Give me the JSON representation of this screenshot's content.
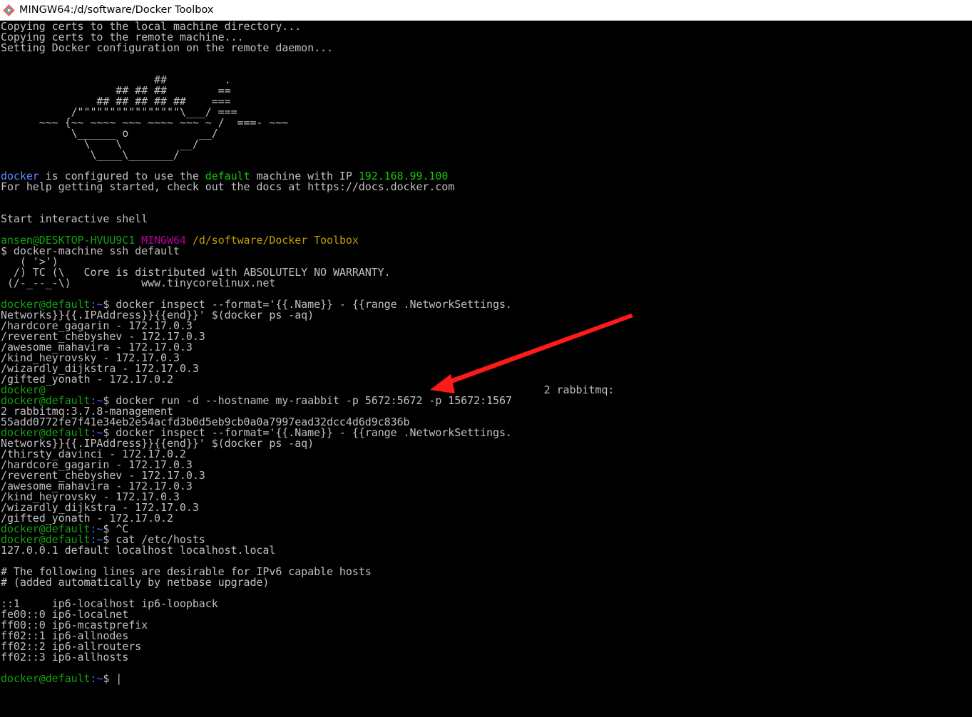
{
  "window": {
    "title": "MINGW64:/d/software/Docker Toolbox",
    "icon": "git-bash-icon"
  },
  "terminal": {
    "lines": [
      {
        "row": 0,
        "segs": [
          {
            "t": "Copying certs to the local machine directory...",
            "c": "white"
          }
        ]
      },
      {
        "row": 1,
        "segs": [
          {
            "t": "Copying certs to the remote machine...",
            "c": "white"
          }
        ]
      },
      {
        "row": 2,
        "segs": [
          {
            "t": "Setting Docker configuration on the remote daemon...",
            "c": "white"
          }
        ]
      },
      {
        "row": 5,
        "segs": [
          {
            "t": "                        ##         .",
            "c": "white"
          }
        ]
      },
      {
        "row": 6,
        "segs": [
          {
            "t": "                  ## ## ##        ==",
            "c": "white"
          }
        ]
      },
      {
        "row": 7,
        "segs": [
          {
            "t": "               ## ## ## ## ##    ===",
            "c": "white"
          }
        ]
      },
      {
        "row": 8,
        "segs": [
          {
            "t": "           /\"\"\"\"\"\"\"\"\"\"\"\"\"\"\"\"\\___/ ===",
            "c": "white"
          }
        ]
      },
      {
        "row": 9,
        "segs": [
          {
            "t": "      ~~~ {~~ ~~~~ ~~~ ~~~~ ~~~ ~ /  ===- ~~~",
            "c": "white"
          }
        ]
      },
      {
        "row": 10,
        "segs": [
          {
            "t": "           \\______ o           __/",
            "c": "white"
          }
        ]
      },
      {
        "row": 11,
        "segs": [
          {
            "t": "             \\    \\         __/",
            "c": "white"
          }
        ]
      },
      {
        "row": 12,
        "segs": [
          {
            "t": "              \\____\\_______/",
            "c": "white"
          }
        ]
      },
      {
        "row": 14,
        "segs": [
          {
            "t": "docker",
            "c": "bblue"
          },
          {
            "t": " is configured to use the ",
            "c": "white"
          },
          {
            "t": "default",
            "c": "bgreen"
          },
          {
            "t": " machine with IP ",
            "c": "white"
          },
          {
            "t": "192.168.99.100",
            "c": "bgreen"
          }
        ]
      },
      {
        "row": 15,
        "segs": [
          {
            "t": "For help getting started, check out the docs at https://docs.docker.com",
            "c": "white"
          }
        ]
      },
      {
        "row": 18,
        "segs": [
          {
            "t": "Start interactive shell",
            "c": "white"
          }
        ]
      },
      {
        "row": 20,
        "segs": [
          {
            "t": "ansen@DESKTOP-HVUU9C1",
            "c": "green"
          },
          {
            "t": " ",
            "c": "white"
          },
          {
            "t": "MINGW64",
            "c": "magenta"
          },
          {
            "t": " ",
            "c": "white"
          },
          {
            "t": "/d/software/Docker Toolbox",
            "c": "yellow"
          }
        ]
      },
      {
        "row": 21,
        "segs": [
          {
            "t": "$ docker-machine ssh default",
            "c": "white"
          }
        ]
      },
      {
        "row": 22,
        "segs": [
          {
            "t": "   ( '>')",
            "c": "white"
          }
        ]
      },
      {
        "row": 23,
        "segs": [
          {
            "t": "  /) TC (\\   Core is distributed with ABSOLUTELY NO WARRANTY.",
            "c": "white"
          }
        ]
      },
      {
        "row": 24,
        "segs": [
          {
            "t": " (/-_--_-\\)           www.tinycorelinux.net",
            "c": "white"
          }
        ]
      },
      {
        "row": 26,
        "segs": [
          {
            "t": "docker@default",
            "c": "green"
          },
          {
            "t": ":~",
            "c": "blue"
          },
          {
            "t": "$ docker inspect --format='{{.Name}} - {{range .NetworkSettings.",
            "c": "white"
          }
        ]
      },
      {
        "row": 27,
        "segs": [
          {
            "t": "Networks}}{{.IPAddress}}{{end}}' $(docker ps -aq)",
            "c": "white"
          }
        ]
      },
      {
        "row": 28,
        "segs": [
          {
            "t": "/hardcore_gagarin - 172.17.0.3",
            "c": "white"
          }
        ]
      },
      {
        "row": 29,
        "segs": [
          {
            "t": "/reverent_chebyshev - 172.17.0.3",
            "c": "white"
          }
        ]
      },
      {
        "row": 30,
        "segs": [
          {
            "t": "/awesome_mahavira - 172.17.0.3",
            "c": "white"
          }
        ]
      },
      {
        "row": 31,
        "segs": [
          {
            "t": "/kind_heyrovsky - 172.17.0.3",
            "c": "white"
          }
        ]
      },
      {
        "row": 32,
        "segs": [
          {
            "t": "/wizardly_dijkstra - 172.17.0.3",
            "c": "white"
          }
        ]
      },
      {
        "row": 33,
        "segs": [
          {
            "t": "/gifted_yonath - 172.17.0.2",
            "c": "white"
          }
        ]
      },
      {
        "row": 34,
        "segs": [
          {
            "t": "docker@",
            "c": "green"
          },
          {
            "t": "                                                                              2 rabbitmq:",
            "c": "white"
          }
        ]
      },
      {
        "row": 35,
        "segs": [
          {
            "t": "docker@default",
            "c": "green"
          },
          {
            "t": ":~",
            "c": "blue"
          },
          {
            "t": "$ docker run -d --hostname my-raabbit -p 5672:5672 -p 15672:1567",
            "c": "white"
          }
        ]
      },
      {
        "row": 36,
        "segs": [
          {
            "t": "2 rabbitmq:3.7.8-management",
            "c": "white"
          }
        ]
      },
      {
        "row": 37,
        "segs": [
          {
            "t": "55add0772fe7f41e34eb2e54acfd3b0d5eb9cb0a0a7997ead32dcc4d6d9c836b",
            "c": "white"
          }
        ]
      },
      {
        "row": 38,
        "segs": [
          {
            "t": "docker@default",
            "c": "green"
          },
          {
            "t": ":~",
            "c": "blue"
          },
          {
            "t": "$ docker inspect --format='{{.Name}} - {{range .NetworkSettings.",
            "c": "white"
          }
        ]
      },
      {
        "row": 39,
        "segs": [
          {
            "t": "Networks}}{{.IPAddress}}{{end}}' $(docker ps -aq)",
            "c": "white"
          }
        ]
      },
      {
        "row": 40,
        "segs": [
          {
            "t": "/thirsty_davinci - 172.17.0.2",
            "c": "white"
          }
        ]
      },
      {
        "row": 41,
        "segs": [
          {
            "t": "/hardcore_gagarin - 172.17.0.3",
            "c": "white"
          }
        ]
      },
      {
        "row": 42,
        "segs": [
          {
            "t": "/reverent_chebyshev - 172.17.0.3",
            "c": "white"
          }
        ]
      },
      {
        "row": 43,
        "segs": [
          {
            "t": "/awesome_mahavira - 172.17.0.3",
            "c": "white"
          }
        ]
      },
      {
        "row": 44,
        "segs": [
          {
            "t": "/kind_heyrovsky - 172.17.0.3",
            "c": "white"
          }
        ]
      },
      {
        "row": 45,
        "segs": [
          {
            "t": "/wizardly_dijkstra - 172.17.0.3",
            "c": "white"
          }
        ]
      },
      {
        "row": 46,
        "segs": [
          {
            "t": "/gifted_yonath - 172.17.0.2",
            "c": "white"
          }
        ]
      },
      {
        "row": 47,
        "segs": [
          {
            "t": "docker@default",
            "c": "green"
          },
          {
            "t": ":~",
            "c": "blue"
          },
          {
            "t": "$ ^C",
            "c": "white"
          }
        ]
      },
      {
        "row": 48,
        "segs": [
          {
            "t": "docker@default",
            "c": "green"
          },
          {
            "t": ":~",
            "c": "blue"
          },
          {
            "t": "$ cat /etc/hosts",
            "c": "white"
          }
        ]
      },
      {
        "row": 49,
        "segs": [
          {
            "t": "127.0.0.1 default localhost localhost.local",
            "c": "white"
          }
        ]
      },
      {
        "row": 51,
        "segs": [
          {
            "t": "# The following lines are desirable for IPv6 capable hosts",
            "c": "white"
          }
        ]
      },
      {
        "row": 52,
        "segs": [
          {
            "t": "# (added automatically by netbase upgrade)",
            "c": "white"
          }
        ]
      },
      {
        "row": 54,
        "segs": [
          {
            "t": "::1     ip6-localhost ip6-loopback",
            "c": "white"
          }
        ]
      },
      {
        "row": 55,
        "segs": [
          {
            "t": "fe00::0 ip6-localnet",
            "c": "white"
          }
        ]
      },
      {
        "row": 56,
        "segs": [
          {
            "t": "ff00::0 ip6-mcastprefix",
            "c": "white"
          }
        ]
      },
      {
        "row": 57,
        "segs": [
          {
            "t": "ff02::1 ip6-allnodes",
            "c": "white"
          }
        ]
      },
      {
        "row": 58,
        "segs": [
          {
            "t": "ff02::2 ip6-allrouters",
            "c": "white"
          }
        ]
      },
      {
        "row": 59,
        "segs": [
          {
            "t": "ff02::3 ip6-allhosts",
            "c": "white"
          }
        ]
      },
      {
        "row": 61,
        "segs": [
          {
            "t": "docker@default",
            "c": "green"
          },
          {
            "t": ":~",
            "c": "blue"
          },
          {
            "t": "$ ",
            "c": "white"
          },
          {
            "t": "|",
            "c": "cursor"
          }
        ]
      }
    ]
  },
  "annotation": {
    "type": "arrow",
    "color": "#ff1a1a",
    "icon": "red-arrow-icon"
  }
}
